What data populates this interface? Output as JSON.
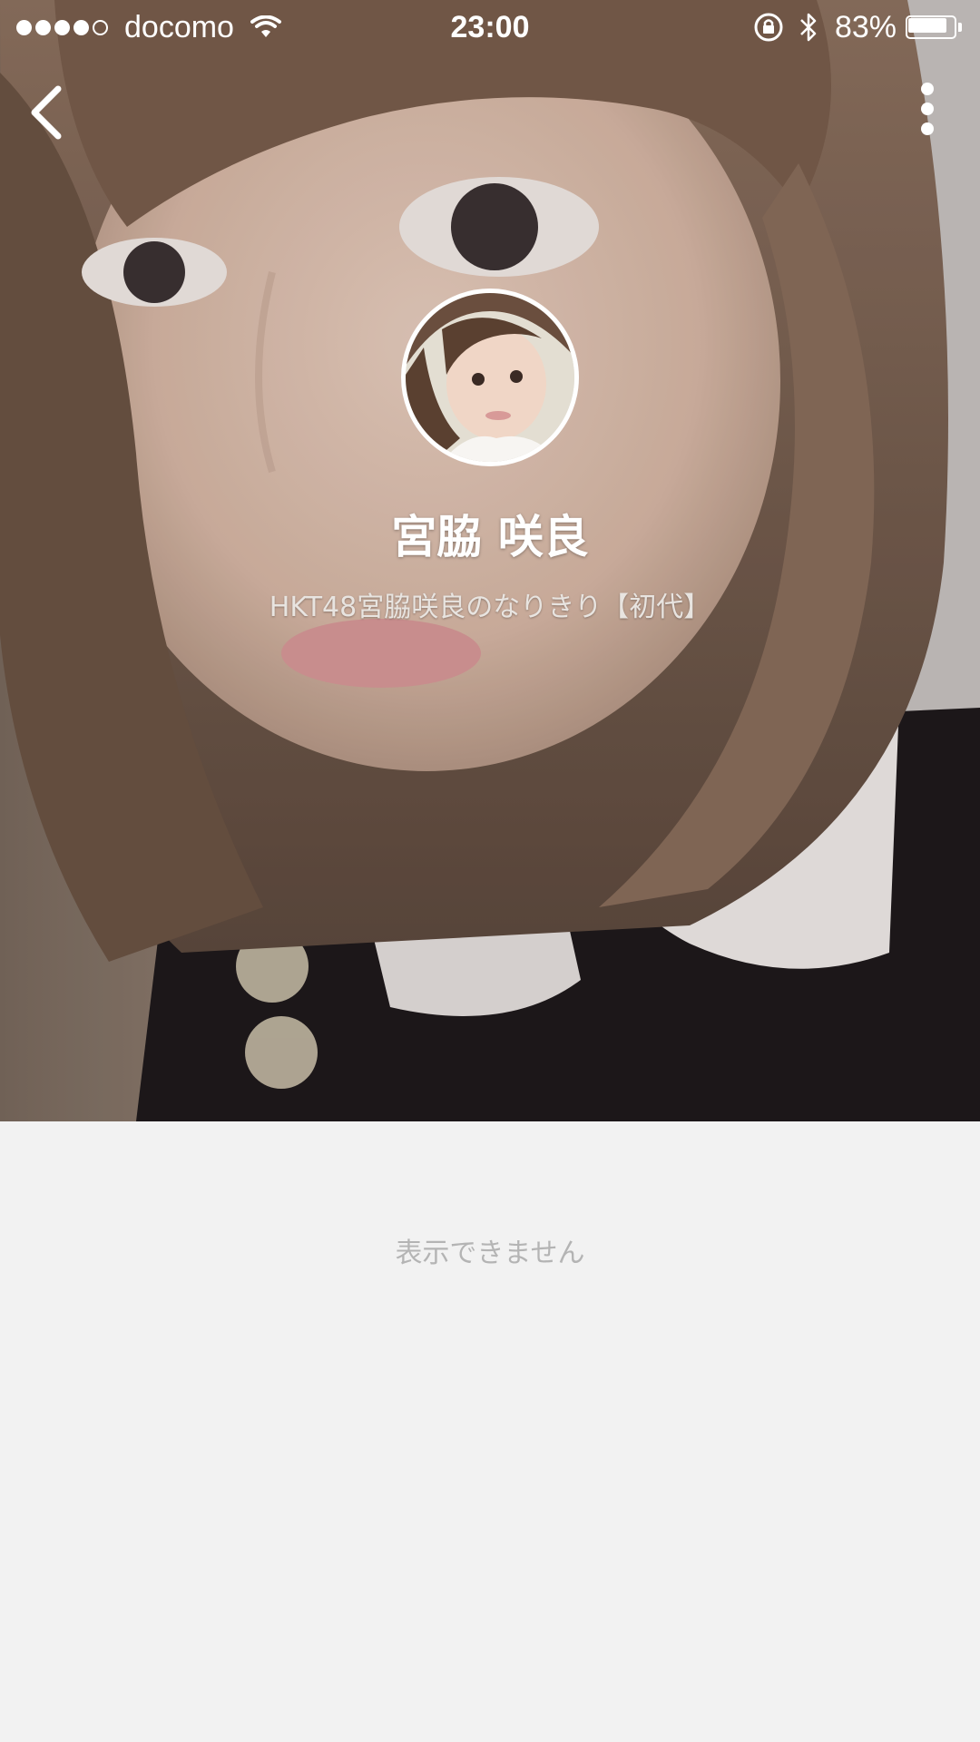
{
  "status_bar": {
    "carrier": "docomo",
    "signal_bars_filled": 4,
    "signal_bars_total": 5,
    "time": "23:00",
    "battery_percent_label": "83%",
    "battery_level": 0.83
  },
  "nav": {
    "back_icon": "chevron-left-icon",
    "more_icon": "vertical-ellipsis-icon"
  },
  "profile": {
    "name": "宮脇 咲良",
    "status_message": "HKT48宮脇咲良のなりきり【初代】"
  },
  "content": {
    "empty_message": "表示できません"
  },
  "colors": {
    "page_background": "#f2f2f2",
    "overlay_text": "#ffffff",
    "empty_text": "#b4b4b4"
  }
}
